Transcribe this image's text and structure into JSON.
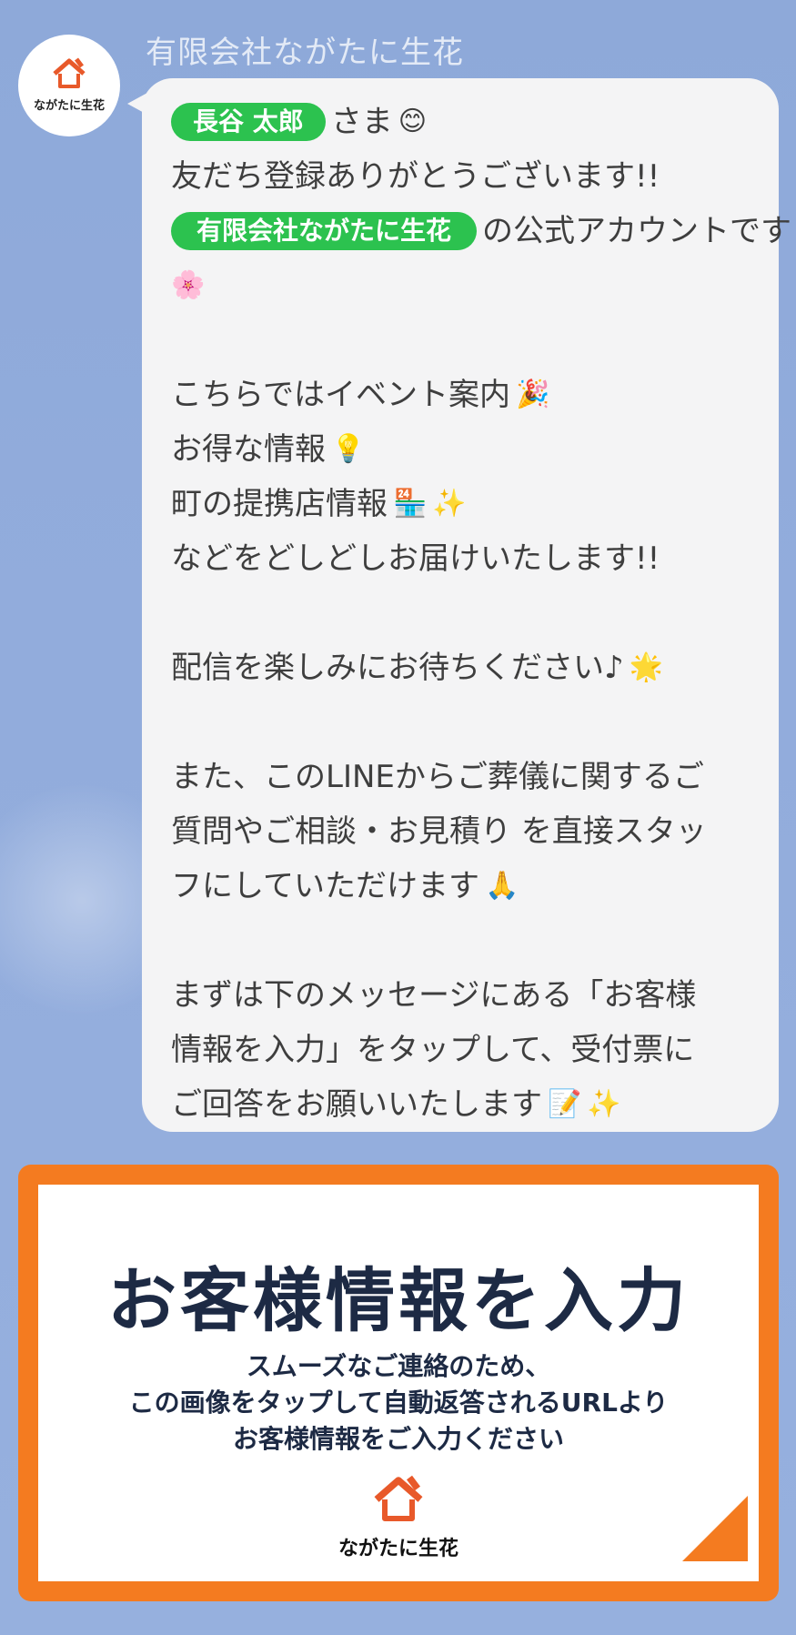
{
  "account": {
    "name": "有限会社ながたに生花",
    "avatar_label": "ながたに生花",
    "icon": "house-heart-logo-icon"
  },
  "message": {
    "user_name": "長谷 太郎",
    "sama": "さま",
    "line1_text": "友だち登録ありがとうございます!!",
    "company_pill": "有限会社ながたに生花",
    "line2_text": "の公式アカウントです",
    "events": "こちらではイベント案内",
    "deals": "お得な情報",
    "partners": "町の提携店情報",
    "deliver": "などをどしどしお届けいたします!!",
    "enjoy": "配信を楽しみにお待ちください♪",
    "also_1": "また、このLINEからご葬儀に関するご",
    "also_2": "質問やご相談・お見積り を直接スタッ",
    "also_3": "フにしていただけます",
    "first_1": "まずは下のメッセージにある「お客様",
    "first_2": "情報を入力」をタップして、受付票に",
    "first_3": "ご回答をお願いいたします",
    "emoji": {
      "smile": "😊",
      "blossom": "🌸",
      "party": "🎉",
      "bulb": "💡",
      "store": "🏪",
      "sparkles": "✨",
      "star": "🌟",
      "pray": "🙏",
      "memo": "📝"
    }
  },
  "card": {
    "title": "お客様情報を入力",
    "desc_1": "スムーズなご連絡のため、",
    "desc_2": "この画像をタップして自動返答されるURLより",
    "desc_3": "お客様情報をご入力ください",
    "logo_label": "ながたに生花",
    "border_color": "#f47b20"
  }
}
